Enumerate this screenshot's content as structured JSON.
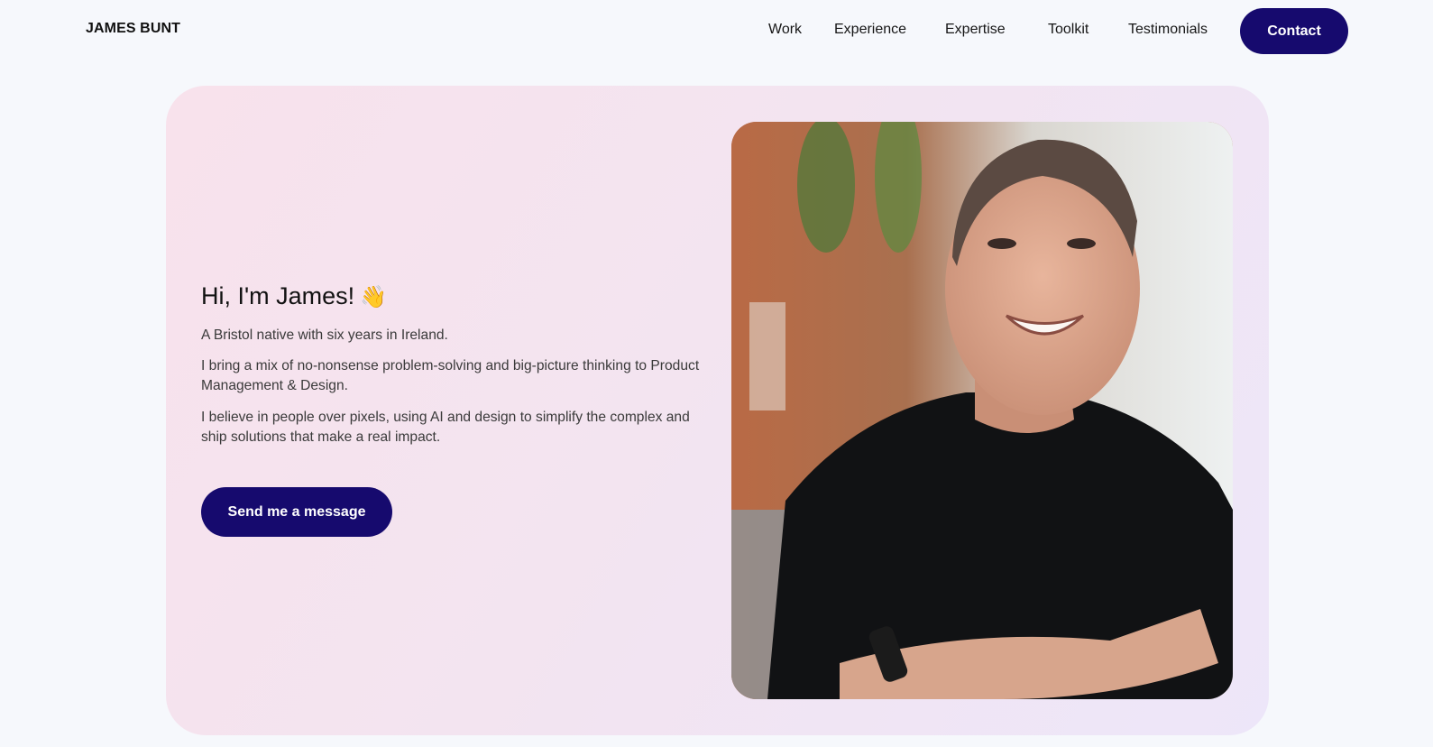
{
  "header": {
    "logo": "JAMES BUNT",
    "nav": [
      "Work",
      "Experience",
      "Expertise",
      "Toolkit",
      "Testimonials"
    ],
    "contact_label": "Contact"
  },
  "hero": {
    "heading": "Hi, I'm James!",
    "emoji": "👋",
    "paragraphs": [
      "A Bristol native with six years in Ireland.",
      "I bring a mix of no-nonsense problem-solving and big-picture thinking to Product Management & Design.",
      "I believe in people over pixels, using AI and design to simplify the complex and ship solutions that make a real impact."
    ],
    "cta_label": "Send me a message"
  },
  "colors": {
    "accent": "#160a6e",
    "card_gradient_start": "#f8e2ec",
    "card_gradient_end": "#ede6f9",
    "page_background": "#f6f8fc"
  }
}
